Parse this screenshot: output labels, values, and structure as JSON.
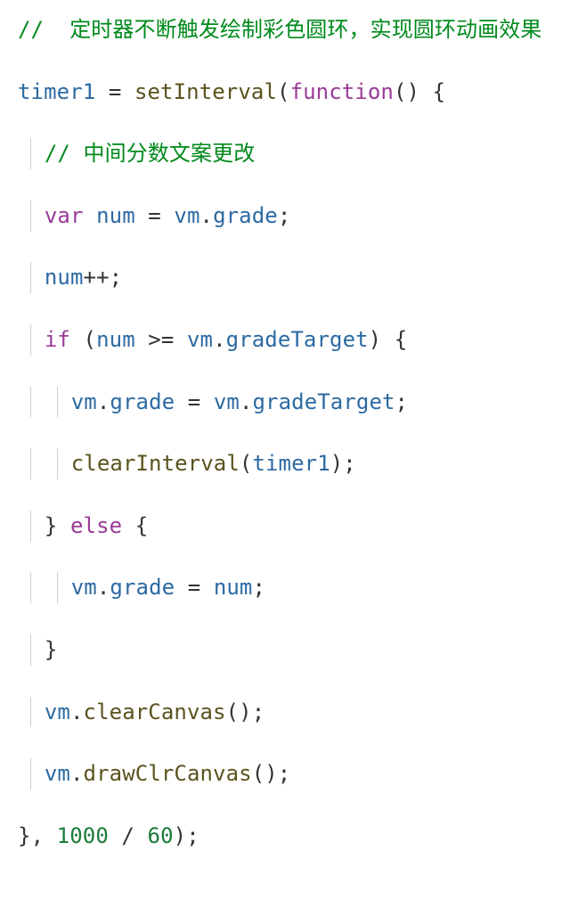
{
  "code": {
    "lines": {
      "l1": {
        "comment": "//  定时器不断触发绘制彩色圆环，实现圆环动画效果"
      },
      "l2": {
        "ident_timer1": "timer1",
        "assign": " = ",
        "fn_setInterval": "setInterval",
        "open": "(",
        "kw_function": "function",
        "paren": "()",
        "brace": " {"
      },
      "l3": {
        "comment": "// 中间分数文案更改"
      },
      "l4": {
        "kw_var": "var",
        "sp": " ",
        "ident_num": "num",
        "assign": " = ",
        "obj_vm": "vm",
        "dot": ".",
        "ident_grade": "grade",
        "semi": ";"
      },
      "l5": {
        "ident_num": "num",
        "inc": "++;",
        "dummy": ""
      },
      "l6": {
        "kw_if": "if",
        "open": " (",
        "ident_num": "num",
        "op": " >= ",
        "obj_vm": "vm",
        "dot": ".",
        "ident_gt": "gradeTarget",
        "close": ") {"
      },
      "l7": {
        "obj_vm": "vm",
        "dot1": ".",
        "ident_grade": "grade",
        "assign": " = ",
        "obj_vm2": "vm",
        "dot2": ".",
        "ident_gt": "gradeTarget",
        "semi": ";"
      },
      "l8": {
        "fn_clear": "clearInterval",
        "open": "(",
        "ident_timer1": "timer1",
        "close": ");"
      },
      "l9": {
        "close": "}",
        "sp": " ",
        "kw_else": "else",
        "open": " {"
      },
      "l10": {
        "obj_vm": "vm",
        "dot": ".",
        "ident_grade": "grade",
        "assign": " = ",
        "ident_num": "num",
        "semi": ";"
      },
      "l11": {
        "close": "}"
      },
      "l12": {
        "obj_vm": "vm",
        "dot": ".",
        "fn": "clearCanvas",
        "paren": "();"
      },
      "l13": {
        "obj_vm": "vm",
        "dot": ".",
        "fn": "drawClrCanvas",
        "paren": "();"
      },
      "l14": {
        "close1": "}",
        "comma": ", ",
        "num1": "1000",
        "op": " / ",
        "num2": "60",
        "close2": ");"
      }
    }
  }
}
